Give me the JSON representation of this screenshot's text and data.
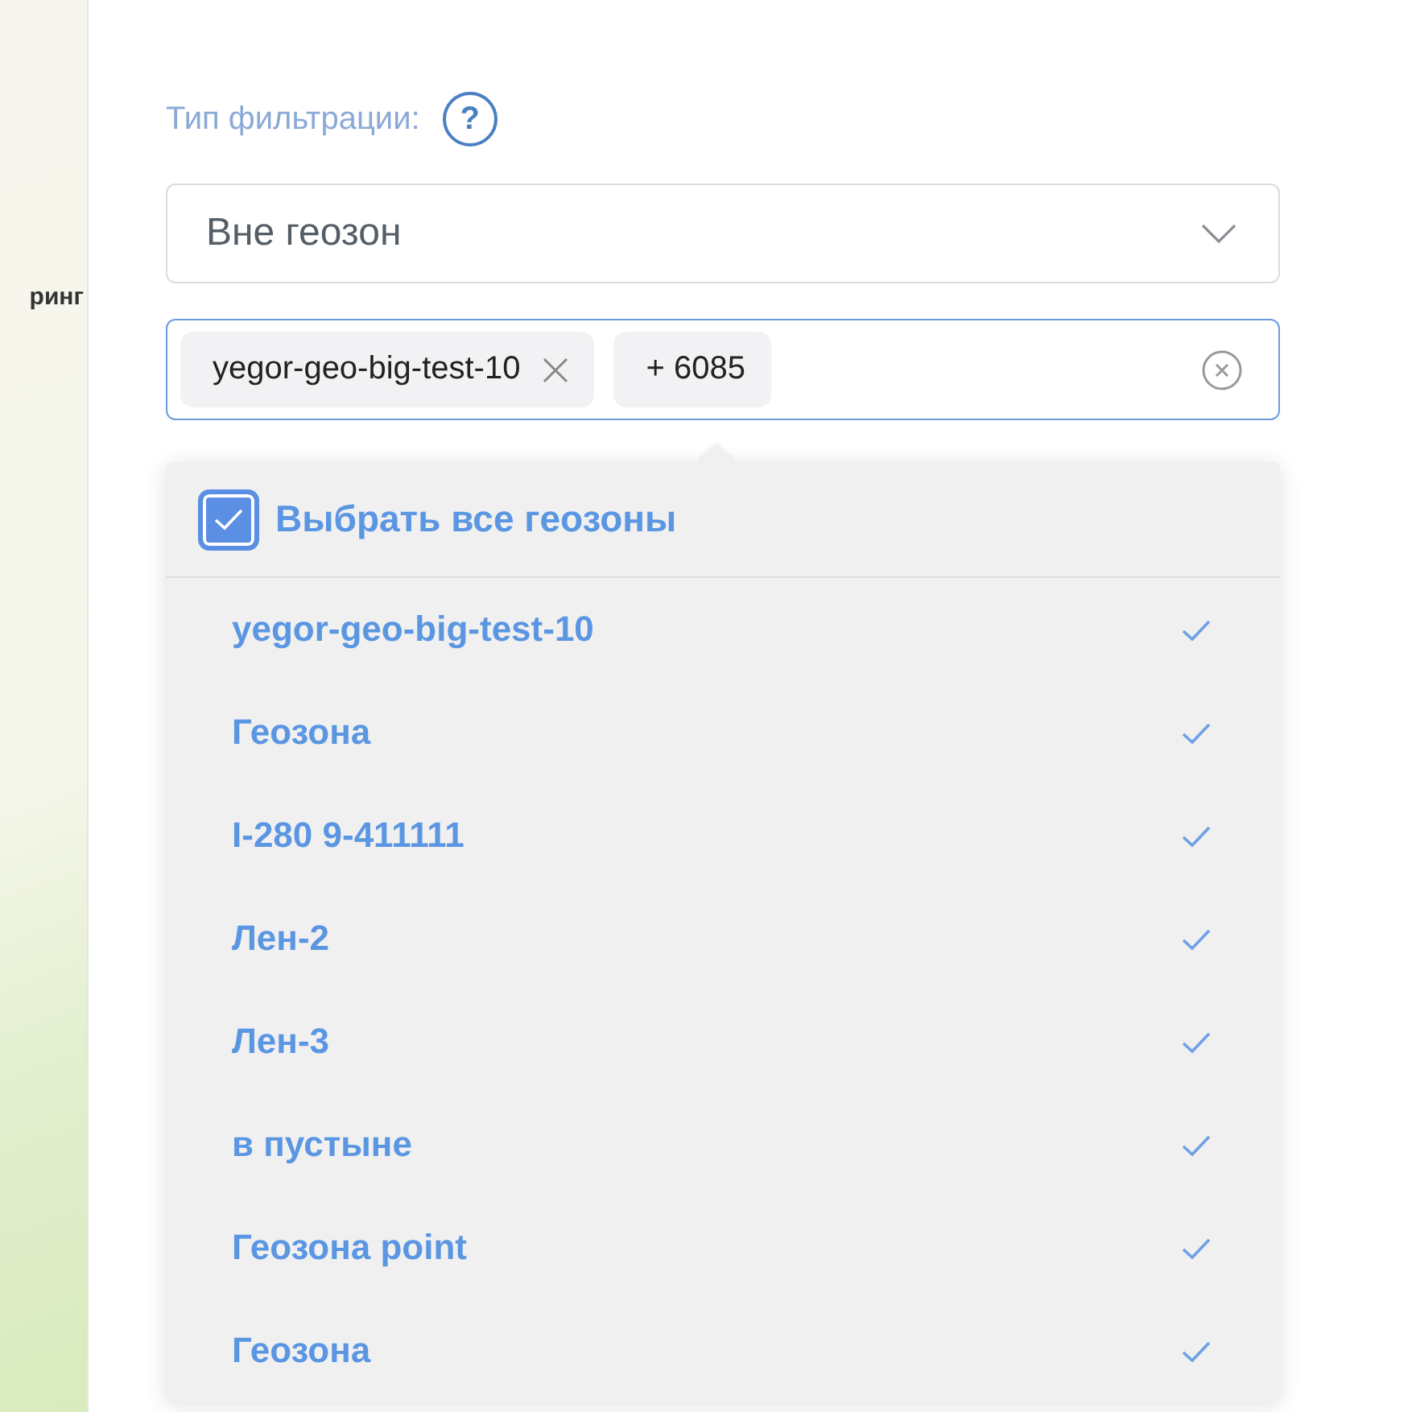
{
  "side_label": "ринг",
  "filter": {
    "label": "Тип фильтрации:",
    "help": "?",
    "value": "Вне геозон"
  },
  "tags": [
    {
      "kind": "tag",
      "text": "yegor-geo-big-test-10"
    },
    {
      "kind": "count",
      "text": "+ 6085"
    }
  ],
  "dropdown": {
    "select_all": {
      "label": "Выбрать все геозоны",
      "checked": true
    },
    "items": [
      {
        "label": "yegor-geo-big-test-10",
        "selected": true
      },
      {
        "label": "Геозона",
        "selected": true
      },
      {
        "label": "I-280 9-411111",
        "selected": true
      },
      {
        "label": "Лен-2",
        "selected": true
      },
      {
        "label": "Лен-3",
        "selected": true
      },
      {
        "label": "в пустыне",
        "selected": true
      },
      {
        "label": "Геозона point",
        "selected": true
      },
      {
        "label": "Геозона",
        "selected": true
      }
    ]
  }
}
